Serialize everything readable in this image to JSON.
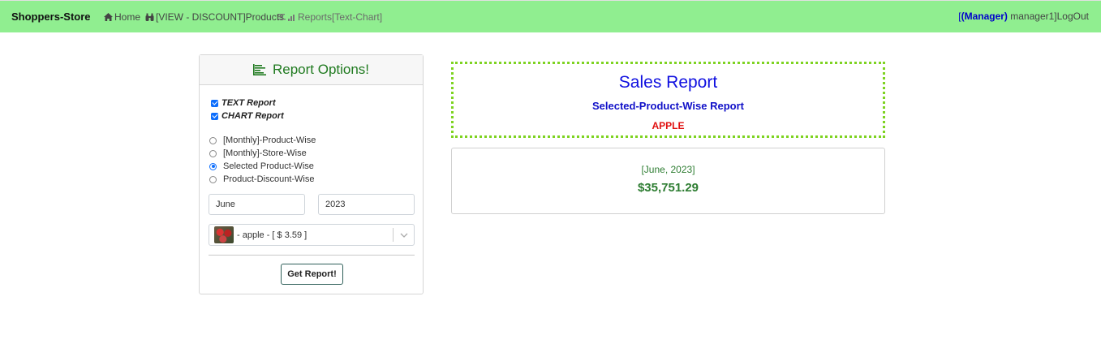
{
  "navbar": {
    "brand": "Shoppers-Store",
    "home_label": "Home",
    "products_label": "[VIEW - DISCOUNT]Products",
    "reports_label": "Reports[Text-Chart]",
    "user_open": "[",
    "role": "(Manager)",
    "username": " manager1]",
    "logout_label": "LogOut",
    "icons": [
      "home-icon",
      "binoculars-icon",
      "report-chart-icon"
    ]
  },
  "options": {
    "title": "Report Options!",
    "checkboxes": [
      {
        "label": "TEXT Report",
        "checked": true
      },
      {
        "label": "CHART Report",
        "checked": true
      }
    ],
    "radios": [
      {
        "label": "[Monthly]-Product-Wise",
        "selected": false
      },
      {
        "label": "[Monthly]-Store-Wise",
        "selected": false
      },
      {
        "label": "Selected Product-Wise",
        "selected": true
      },
      {
        "label": "Product-Discount-Wise",
        "selected": false
      }
    ],
    "month_value": "June",
    "year_value": "2023",
    "product_select_value": "- apple - [ $ 3.59 ]",
    "get_report_label": "Get Report!"
  },
  "report": {
    "title": "Sales Report",
    "subtitle": "Selected-Product-Wise Report",
    "product": "APPLE",
    "period": "[June, 2023]",
    "amount": "$35,751.29"
  },
  "colors": {
    "navbar_bg": "#90ee90",
    "accent_green": "#2e7d32",
    "title_blue": "#1010e0",
    "product_red": "#e01010",
    "dotted_border": "#7ed321"
  }
}
